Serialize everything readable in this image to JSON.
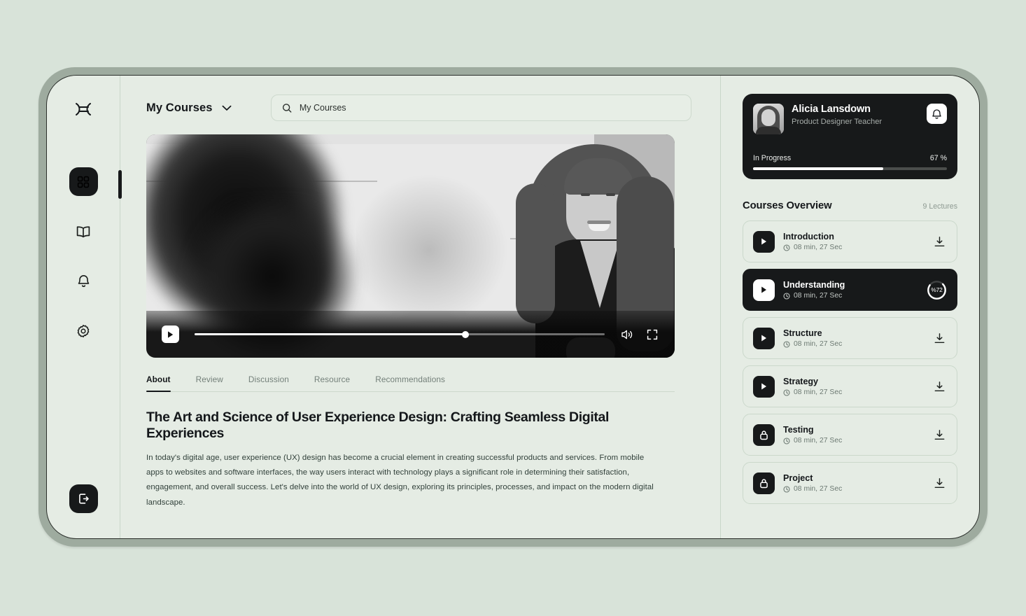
{
  "app": {
    "background_color": "#d8e3d9",
    "bezel_color": "#9eab9f",
    "screen_color": "#e5ece4",
    "accent_dark": "#17191a"
  },
  "sidebar": {
    "logo_name": "app-logo",
    "items": [
      {
        "name": "dashboard",
        "icon": "grid-icon",
        "active": true
      },
      {
        "name": "library",
        "icon": "book-icon",
        "active": false
      },
      {
        "name": "notifications",
        "icon": "bell-icon",
        "active": false
      },
      {
        "name": "settings",
        "icon": "gear-icon",
        "active": false
      }
    ],
    "logout": {
      "name": "logout",
      "icon": "logout-icon"
    }
  },
  "topbar": {
    "dropdown_label": "My Courses",
    "dropdown_icon": "chevron-down-icon",
    "search": {
      "icon": "search-icon",
      "value": "",
      "placeholder": "My Courses"
    }
  },
  "video": {
    "play_icon": "play-icon",
    "volume_icon": "volume-icon",
    "fullscreen_icon": "fullscreen-icon",
    "progress_percent": 66
  },
  "tabs": [
    {
      "label": "About",
      "active": true
    },
    {
      "label": "Review",
      "active": false
    },
    {
      "label": "Discussion",
      "active": false
    },
    {
      "label": "Resource",
      "active": false
    },
    {
      "label": "Recommendations",
      "active": false
    }
  ],
  "article": {
    "title": "The Art and Science of User Experience Design: Crafting Seamless Digital Experiences",
    "body": "In today's digital age, user experience (UX) design has become a crucial element in creating successful products and services. From mobile apps to websites and software interfaces, the way users interact with technology plays a significant role in determining their satisfaction, engagement, and overall success. Let's delve into the world of UX design, exploring its principles, processes, and impact on the modern digital landscape."
  },
  "profile": {
    "name": "Alicia Lansdown",
    "role": "Product Designer Teacher",
    "bell_icon": "bell-icon",
    "avatar_name": "avatar",
    "progress_label": "In Progress",
    "progress_value": "67 %",
    "progress_percent": 67
  },
  "overview": {
    "title": "Courses Overview",
    "count_label": "9 Lectures",
    "lectures": [
      {
        "title": "Introduction",
        "duration": "08 min, 27 Sec",
        "icon": "play-icon",
        "action": "download-icon",
        "active": false,
        "locked": false
      },
      {
        "title": "Understanding",
        "duration": "08 min, 27 Sec",
        "icon": "play-icon",
        "action": "progress-ring",
        "active": true,
        "locked": false,
        "progress_label": "%72",
        "progress_percent": 72
      },
      {
        "title": "Structure",
        "duration": "08 min, 27 Sec",
        "icon": "play-icon",
        "action": "download-icon",
        "active": false,
        "locked": false
      },
      {
        "title": "Strategy",
        "duration": "08 min, 27 Sec",
        "icon": "play-icon",
        "action": "download-icon",
        "active": false,
        "locked": false
      },
      {
        "title": "Testing",
        "duration": "08 min, 27 Sec",
        "icon": "lock-icon",
        "action": "download-icon",
        "active": false,
        "locked": true
      },
      {
        "title": "Project",
        "duration": "08 min, 27 Sec",
        "icon": "lock-icon",
        "action": "download-icon",
        "active": false,
        "locked": true
      }
    ],
    "clock_icon": "clock-icon"
  }
}
